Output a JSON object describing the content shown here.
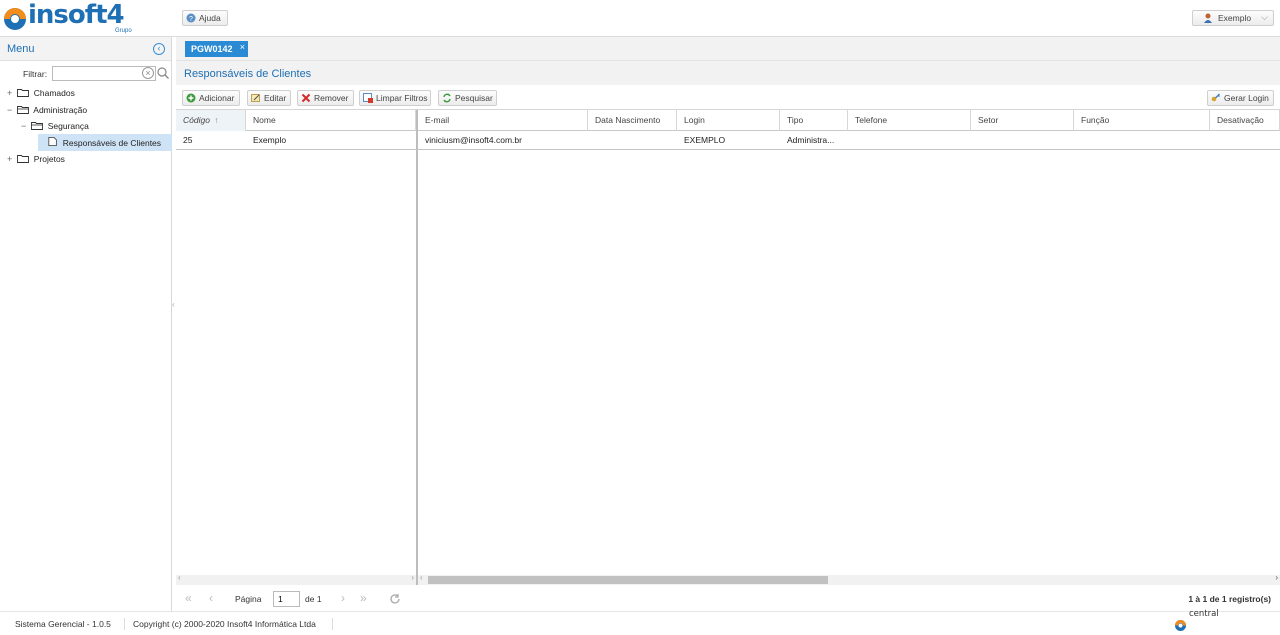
{
  "header": {
    "logo_text": "insoft4",
    "logo_sub": "Grupo",
    "help_label": "Ajuda",
    "user_label": "Exemplo"
  },
  "sidebar": {
    "title": "Menu",
    "filter_label": "Filtrar:",
    "filter_value": "",
    "tree": [
      {
        "label": "Chamados",
        "toggle": "+",
        "icon": "folder-icon"
      },
      {
        "label": "Administração",
        "toggle": "−",
        "icon": "folder-open-icon"
      },
      {
        "label": "Segurança",
        "toggle": "−",
        "icon": "folder-open-icon"
      },
      {
        "label": "Responsáveis de Clientes",
        "toggle": "",
        "icon": "document-icon",
        "selected": true
      },
      {
        "label": "Projetos",
        "toggle": "+",
        "icon": "folder-icon"
      }
    ]
  },
  "tabs": [
    {
      "label": "PGW0142",
      "close": "×"
    }
  ],
  "page_title": "Responsáveis de Clientes",
  "toolbar": {
    "add": "Adicionar",
    "edit": "Editar",
    "remove": "Remover",
    "clear_filters": "Limpar Filtros",
    "search": "Pesquisar",
    "generate_login": "Gerar Login"
  },
  "grid": {
    "columns": [
      "Código",
      "Nome",
      "E-mail",
      "Data Nascimento",
      "Login",
      "Tipo",
      "Telefone",
      "Setor",
      "Função",
      "Desativação"
    ],
    "sort_indicator": "↑",
    "rows": [
      [
        "25",
        "Exemplo",
        "viniciusm@insoft4.com.br",
        "",
        "EXEMPLO",
        "Administra...",
        "",
        "",
        "",
        ""
      ]
    ]
  },
  "pager": {
    "page_label": "Página",
    "page": "1",
    "of_label": "de 1",
    "info": "1 à 1 de 1 registro(s)"
  },
  "footer": {
    "system": "Sistema Gerencial - 1.0.5",
    "copyright": "Copyright (c) 2000-2020 Insoft4 Informática Ltda",
    "brand": "central"
  },
  "colors": {
    "accent": "#2a8ad4",
    "brand_blue": "#1e6fb4",
    "brand_orange": "#f28c1a",
    "selection": "#cfe3f7"
  }
}
